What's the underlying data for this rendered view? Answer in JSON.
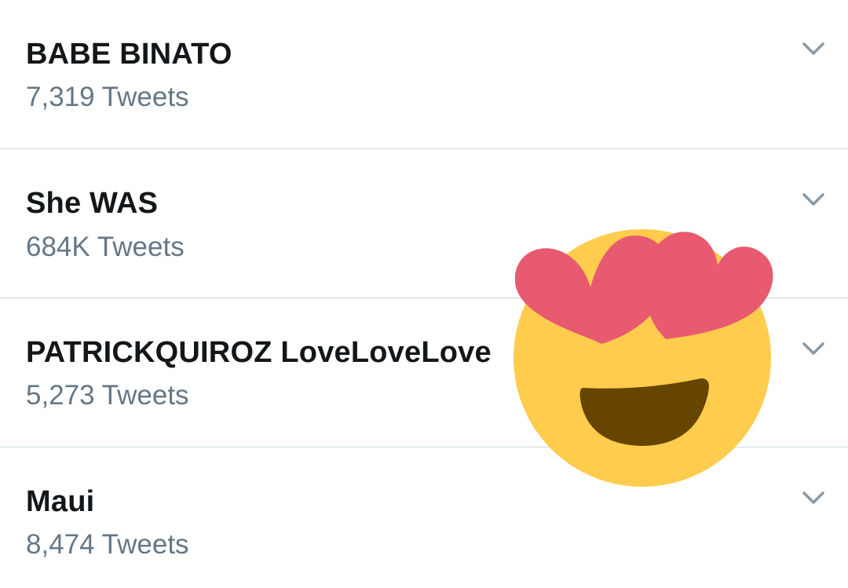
{
  "trends": [
    {
      "name": "BABE BINATO",
      "count": "7,319 Tweets"
    },
    {
      "name": "She WAS",
      "count": "684K Tweets"
    },
    {
      "name": "PATRICKQUIROZ LoveLoveLove",
      "count": "5,273 Tweets"
    },
    {
      "name": "Maui",
      "count": "8,474 Tweets"
    }
  ],
  "icons": {
    "chevron": "chevron-down-icon",
    "emoji": "heart-eyes-emoji"
  },
  "colors": {
    "title": "#14171a",
    "subtitle": "#657786",
    "divider": "#cfd9de",
    "chevron": "#8899a6",
    "emoji_face": "#ffcc4d",
    "emoji_heart": "#e75a70",
    "emoji_mouth": "#664500"
  }
}
